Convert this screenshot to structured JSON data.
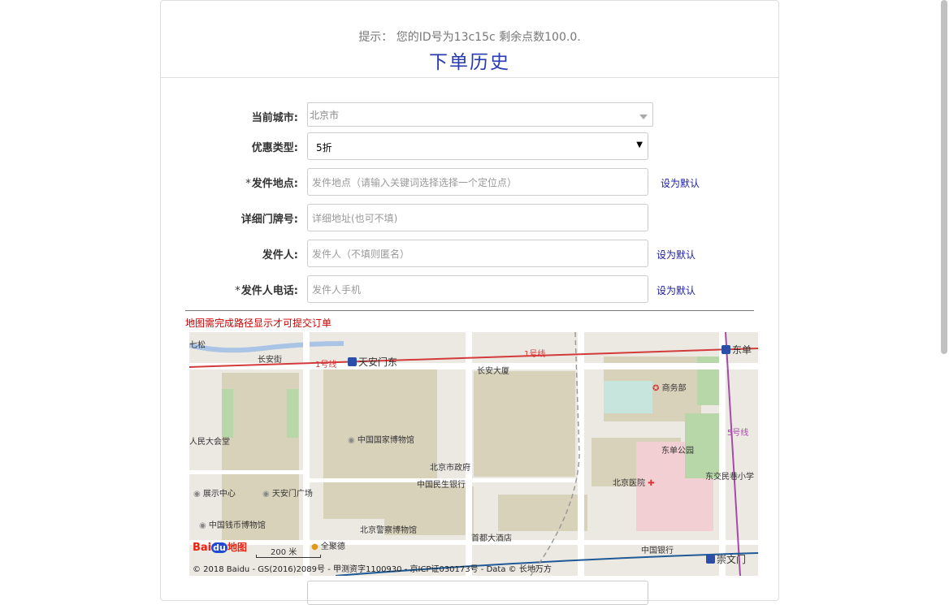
{
  "header": {
    "tip": "提示： 您的ID号为13c15c 剩余点数100.0.",
    "title": "下单历史"
  },
  "form": {
    "city": {
      "label": "当前城市:",
      "value": "北京市"
    },
    "discount": {
      "label": "优惠类型:",
      "value": "5折"
    },
    "origin": {
      "star": "*",
      "label": "发件地点:",
      "placeholder": "发件地点（请输入关键词选择选择一个定位点）",
      "default_link": "设为默认"
    },
    "detail": {
      "label": "详细门牌号:",
      "placeholder": "详细地址(也可不填)"
    },
    "sender": {
      "label": "发件人:",
      "placeholder": "发件人（不填则匿名）",
      "default_link": "设为默认"
    },
    "phone": {
      "star": "*",
      "label": "发件人电话:",
      "placeholder": "发件人手机",
      "default_link": "设为默认"
    }
  },
  "map": {
    "warning": "地图需完成路径显示才可提交订单",
    "labels": {
      "changanjie": "长安街",
      "qisong": "七松",
      "line1_a": "1号线",
      "line1_b": "1号线",
      "tiananmen_east": "天安门东",
      "dongdan": "东单",
      "changan_tower": "长安大厦",
      "commerce": "商务部",
      "museum": "中国国家博物馆",
      "people_hall": "人民大会堂",
      "dongdan_park": "东单公园",
      "line5": "5号线",
      "city_gov": "北京市政府",
      "dongjiao": "东交民巷小学",
      "minsheng": "中国民生银行",
      "hospital": "北京医院",
      "exhibition": "展示中心",
      "square": "天安门广场",
      "coin_museum": "中国钱币博物馆",
      "police_museum": "北京警察博物馆",
      "capital_hotel": "首都大酒店",
      "quanjude": "全聚德",
      "boc": "中国银行",
      "chongwenmen": "崇文门",
      "scale": "200 米",
      "logo_a": "Bai",
      "logo_b": "du",
      "logo_c": "地图",
      "copyright": "© 2018 Baidu - GS(2016)2089号 - 甲测资字1100930 - 京ICP证030173号 - Data © 长地万方"
    },
    "colors": {
      "line1": "#d33b3b",
      "line5": "#a54aa8",
      "line2": "#1f5a96",
      "block": "#d9d2bb",
      "green": "#b7d7a8",
      "water": "#aac4e6"
    }
  }
}
